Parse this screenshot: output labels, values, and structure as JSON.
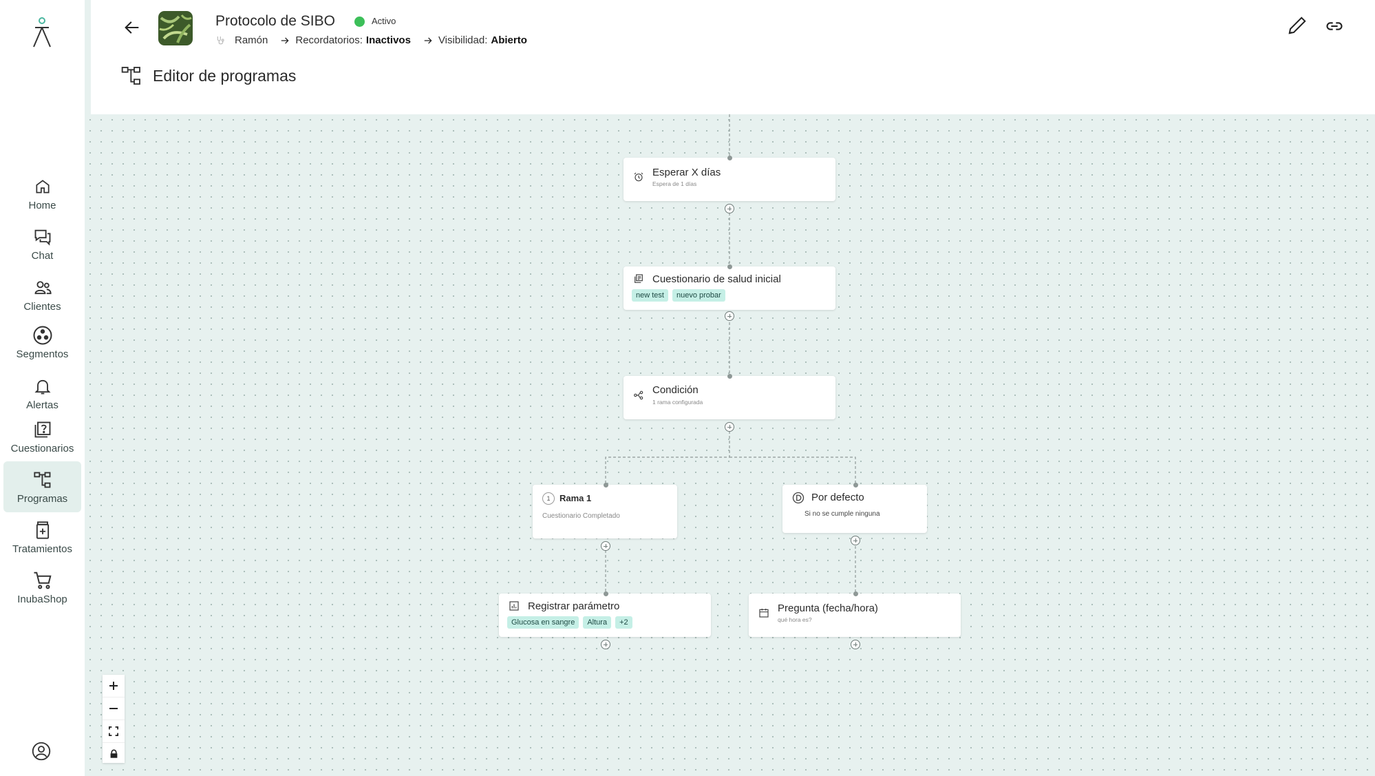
{
  "sidebar": {
    "items": [
      {
        "label": "Home",
        "icon": "home-icon"
      },
      {
        "label": "Chat",
        "icon": "chat-icon"
      },
      {
        "label": "Clientes",
        "icon": "users-icon"
      },
      {
        "label": "Segmentos",
        "icon": "segments-icon"
      },
      {
        "label": "Alertas",
        "icon": "bell-icon"
      },
      {
        "label": "Cuestionarios",
        "icon": "questionnaire-icon"
      },
      {
        "label": "Programas",
        "icon": "program-tree-icon",
        "active": true
      },
      {
        "label": "Tratamientos",
        "icon": "treatment-icon"
      },
      {
        "label": "InubaShop",
        "icon": "cart-icon"
      }
    ]
  },
  "header": {
    "title": "Protocolo de SIBO",
    "status": "Activo",
    "status_color": "#3cbf59",
    "owner": "Ramón",
    "reminders_label": "Recordatorios:",
    "reminders_value": "Inactivos",
    "visibility_label": "Visibilidad:",
    "visibility_value": "Abierto",
    "editor_title": "Editor de programas"
  },
  "nodes": {
    "wait": {
      "title": "Esperar X días",
      "subtitle": "Espera de 1 días"
    },
    "questionnaire": {
      "title": "Cuestionario de salud inicial",
      "tags": [
        "new test",
        "nuevo probar"
      ]
    },
    "condition": {
      "title": "Condición",
      "subtitle": "1 rama configurada"
    },
    "branch1": {
      "number": "1",
      "title": "Rama 1",
      "subtitle": "Cuestionario Completado"
    },
    "default": {
      "title": "Por defecto",
      "subtitle": "Si no se cumple ninguna"
    },
    "register": {
      "title": "Registrar parámetro",
      "tags": [
        "Glucosa en sangre",
        "Altura",
        "+2"
      ]
    },
    "question": {
      "title": "Pregunta (fecha/hora)",
      "subtitle": "qué hora es?"
    }
  },
  "colors": {
    "accent": "#c5efe6",
    "canvas": "#e7f1ef",
    "active_nav": "#e3efec"
  }
}
